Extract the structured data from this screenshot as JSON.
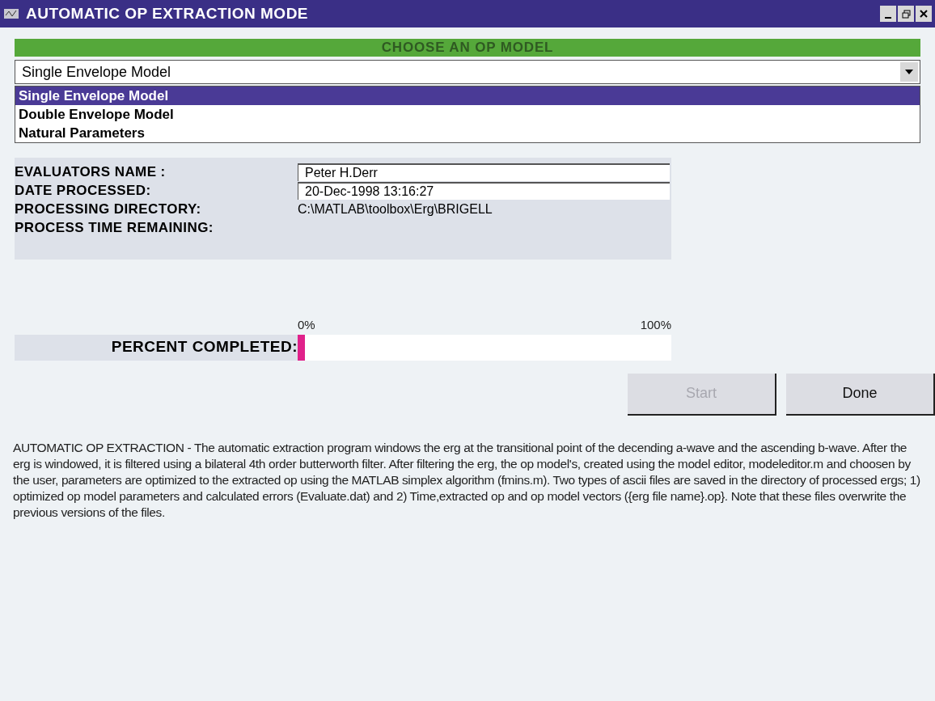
{
  "window": {
    "title": "AUTOMATIC OP EXTRACTION MODE"
  },
  "model_header": "CHOOSE AN OP MODEL",
  "model_select": {
    "value": "Single Envelope Model",
    "options": [
      {
        "label": "Single Envelope Model",
        "selected": true
      },
      {
        "label": "Double Envelope Model",
        "selected": false
      },
      {
        "label": "Natural Parameters",
        "selected": false
      }
    ]
  },
  "fields": [
    {
      "kind": "input",
      "label": "EVALUATORS NAME :",
      "value": "Peter H.Derr"
    },
    {
      "kind": "input",
      "label": "DATE PROCESSED:",
      "value": "20-Dec-1998 13:16:27"
    },
    {
      "kind": "text",
      "label": "PROCESSING DIRECTORY:",
      "value": "C:\\MATLAB\\toolbox\\Erg\\BRIGELL"
    },
    {
      "kind": "text",
      "label": "PROCESS TIME REMAINING:"
    }
  ],
  "progress": {
    "label": "PERCENT COMPLETED:",
    "min_label": "0%",
    "max_label": "100%",
    "level": 0.02
  },
  "buttons": [
    {
      "label": "Start",
      "disabled": true
    },
    {
      "label": "Done",
      "disabled": false
    }
  ],
  "description": "AUTOMATIC OP EXTRACTION - The automatic extraction program windows the erg at the transitional point of the decending a-wave and the ascending b-wave. After the erg is windowed, it is filtered using a bilateral 4th order butterworth filter. After filtering the erg, the op model's, created using the model editor, modeleditor.m and choosen by the user, parameters are optimized to the extracted op using the MATLAB simplex algorithm (fmins.m). Two types of ascii files are saved in the directory of processed ergs; 1) optimized op model parameters and calculated errors (Evaluate.dat) and 2) Time,extracted op and op model vectors ({erg file name}.op}. Note that these files overwrite the previous versions of the files."
}
